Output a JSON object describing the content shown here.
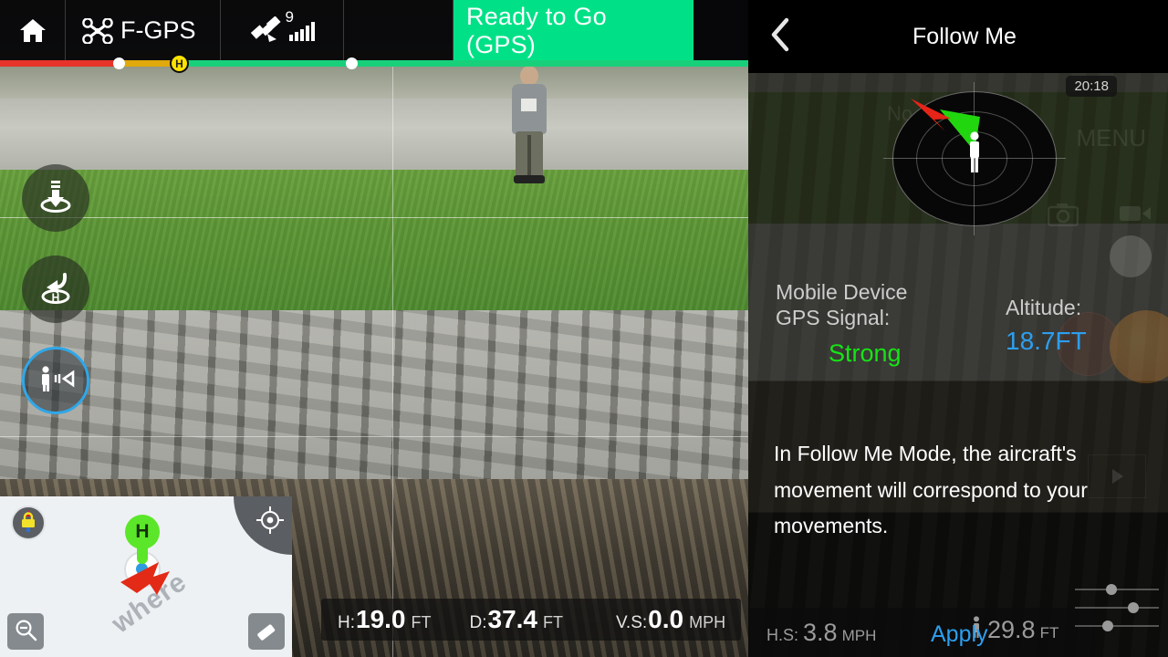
{
  "topbar": {
    "home_icon": "home-icon",
    "drone_icon": "drone-icon",
    "flight_mode": "F-GPS",
    "satellite_icon": "satellite-icon",
    "satellite_count": "9",
    "signal_bars": 5,
    "status": "Ready to Go (GPS)",
    "status_color": "#00e187"
  },
  "battery": {
    "red_color": "#e8332a",
    "yellow_color": "#e0a90c",
    "green_color": "#18d07a",
    "home_marker": "H"
  },
  "side_buttons": [
    {
      "name": "auto-landing-button",
      "icon": "landing-icon"
    },
    {
      "name": "return-to-home-button",
      "icon": "return-home-icon"
    },
    {
      "name": "follow-me-button",
      "icon": "follow-me-icon",
      "active": true
    }
  ],
  "minimap": {
    "lock_icon": "map-lock-icon",
    "locate_icon": "crosshair-locate-icon",
    "zoom_out_icon": "zoom-out-icon",
    "erase_icon": "eraser-icon",
    "home_pin": "H",
    "watermark": "where"
  },
  "telemetry": {
    "height": {
      "key": "H:",
      "value": "19.0",
      "unit": "FT"
    },
    "distance": {
      "key": "D:",
      "value": "37.4",
      "unit": "FT"
    },
    "vertical_speed": {
      "key": "V.S:",
      "value": "0.0",
      "unit": "MPH"
    }
  },
  "right_panel": {
    "back_icon": "back-chevron-icon",
    "title": "Follow Me",
    "timestamp": "20:18",
    "no_sd_card": "No SD Card",
    "menu_label": "MENU",
    "camera_icon": "camera-icon",
    "video_icon": "video-camera-icon",
    "shutter_button": "shutter-button",
    "radar": {
      "name": "follow-me-radar",
      "person_icon": "person-icon",
      "aircraft_marker": "aircraft-arrow-icon",
      "fov_color": "#21d60f",
      "aircraft_color": "#e52418"
    },
    "gps_label": "Mobile Device\nGPS Signal:",
    "gps_label_line1": "Mobile Device",
    "gps_label_line2": "GPS Signal:",
    "gps_value": "Strong",
    "gps_value_color": "#17e317",
    "altitude_label": "Altitude:",
    "altitude_value": "18.7FT",
    "altitude_color": "#2c9ff0",
    "description": "In Follow Me Mode, the aircraft's movement will correspond to your movements.",
    "horizontal_speed": {
      "key": "H.S:",
      "value": "3.8",
      "unit": "MPH"
    },
    "apply_label": "Apply",
    "person_distance": {
      "icon": "person-distance-icon",
      "value": "29.8",
      "unit": "FT"
    },
    "sliders_icon": "settings-sliders-icon"
  }
}
